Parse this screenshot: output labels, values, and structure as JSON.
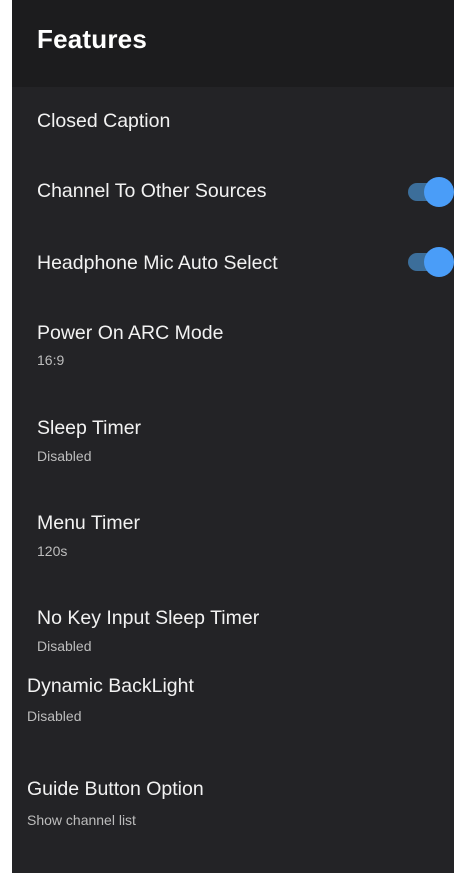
{
  "header": {
    "title": "Features"
  },
  "items": [
    {
      "label": "Closed Caption"
    },
    {
      "label": "Channel To Other Sources",
      "toggle": true
    },
    {
      "label": "Headphone Mic Auto Select",
      "toggle": true
    },
    {
      "label": "Power On ARC Mode",
      "value": "16:9"
    },
    {
      "label": "Sleep Timer",
      "value": "Disabled"
    },
    {
      "label": "Menu Timer",
      "value": "120s"
    },
    {
      "label": "No Key Input Sleep Timer",
      "value": "Disabled"
    },
    {
      "label": "Dynamic BackLight",
      "value": "Disabled"
    },
    {
      "label": "Guide Button Option",
      "value": "Show channel list"
    }
  ],
  "colors": {
    "background": "#232326",
    "header": "#1c1c1e",
    "toggle_on_thumb": "#4a9df8",
    "toggle_on_track": "#3c6e9a"
  }
}
